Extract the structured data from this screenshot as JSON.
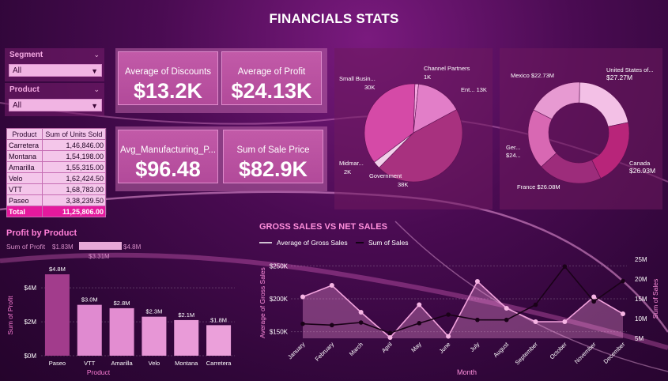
{
  "title": "FINANCIALS STATS",
  "segment_slicer": {
    "label": "Segment",
    "value": "All"
  },
  "product_slicer": {
    "label": "Product",
    "value": "All"
  },
  "product_table": {
    "headers": [
      "Product",
      "Sum of Units Sold"
    ],
    "rows": [
      [
        "Carretera",
        "1,46,846.00"
      ],
      [
        "Montana",
        "1,54,198.00"
      ],
      [
        "Amarilla",
        "1,55,315.00"
      ],
      [
        "Velo",
        "1,62,424.50"
      ],
      [
        "VTT",
        "1,68,783.00"
      ],
      [
        "Paseo",
        "3,38,239.50"
      ]
    ],
    "total": [
      "Total",
      "11,25,806.00"
    ]
  },
  "kpis": [
    {
      "label": "Average of Discounts",
      "value": "$13.2K"
    },
    {
      "label": "Average of Profit",
      "value": "$24.13K"
    },
    {
      "label": "Avg_Manufacturing_P...",
      "value": "$96.48"
    },
    {
      "label": "Sum of Sale Price",
      "value": "$82.9K"
    }
  ],
  "colors": {
    "accent": "#e4199d",
    "bar": "#e487cf",
    "pink_light": "#f3c5ea"
  },
  "chart_data": [
    {
      "type": "pie",
      "title": "",
      "slices": [
        {
          "label": "Channel Partners",
          "value_label": "1K",
          "value": 1
        },
        {
          "label": "Ent...",
          "value_label": "13K",
          "value": 13
        },
        {
          "label": "Government",
          "value_label": "38K",
          "value": 38
        },
        {
          "label": "Midmar...",
          "value_label": "2K",
          "value": 2
        },
        {
          "label": "Small Busin...",
          "value_label": "30K",
          "value": 30
        }
      ]
    },
    {
      "type": "pie",
      "donut": true,
      "title": "",
      "slices": [
        {
          "label": "United States of...",
          "value_label": "$27.27M",
          "value": 27.27
        },
        {
          "label": "Canada",
          "value_label": "$26.93M",
          "value": 26.93
        },
        {
          "label": "France",
          "value_label": "$26.08M",
          "value": 26.08
        },
        {
          "label": "Ger...",
          "value_label": "$24...",
          "value": 24.5
        },
        {
          "label": "Mexico",
          "value_label": "$22.73M",
          "value": 22.73
        }
      ]
    },
    {
      "type": "bar",
      "title": "Profit by Product",
      "xlabel": "Product",
      "ylabel": "Sum of Profit",
      "legend": {
        "label": "Sum of Profit",
        "min": "$1.83M",
        "mid": "$3.31M",
        "max": "$4.8M"
      },
      "categories": [
        "Paseo",
        "VTT",
        "Amarilla",
        "Velo",
        "Montana",
        "Carretera"
      ],
      "values": [
        4.8,
        3.0,
        2.8,
        2.3,
        2.1,
        1.8
      ],
      "value_labels": [
        "$4.8M",
        "$3.0M",
        "$2.8M",
        "$2.3M",
        "$2.1M",
        "$1.8M"
      ],
      "yticks": [
        "$0M",
        "$2M",
        "$4M"
      ],
      "ylim": [
        0,
        5.5
      ]
    },
    {
      "type": "line",
      "title": "GROSS SALES VS NET SALES",
      "xlabel": "Month",
      "ylabel_left": "Average of Gross Sales",
      "ylabel_right": "Sum of Sales",
      "categories": [
        "January",
        "February",
        "March",
        "April",
        "May",
        "June",
        "July",
        "August",
        "September",
        "October",
        "November",
        "December"
      ],
      "series": [
        {
          "name": "Average of Gross Sales",
          "axis": "left",
          "values": [
            162,
            160,
            164,
            148,
            163,
            176,
            168,
            168,
            191,
            249,
            196,
            227
          ]
        },
        {
          "name": "Sum of  Sales",
          "axis": "right",
          "values": [
            15.5,
            18.4,
            11.6,
            5.2,
            13.5,
            5.5,
            19.4,
            12.6,
            9.2,
            9.2,
            15.5,
            11.2
          ]
        }
      ],
      "left_ticks": [
        "$150K",
        "$200K",
        "$250K"
      ],
      "left_lim": [
        140,
        260
      ],
      "right_ticks": [
        "5M",
        "10M",
        "15M",
        "20M",
        "25M"
      ],
      "right_lim": [
        5,
        25
      ]
    }
  ]
}
